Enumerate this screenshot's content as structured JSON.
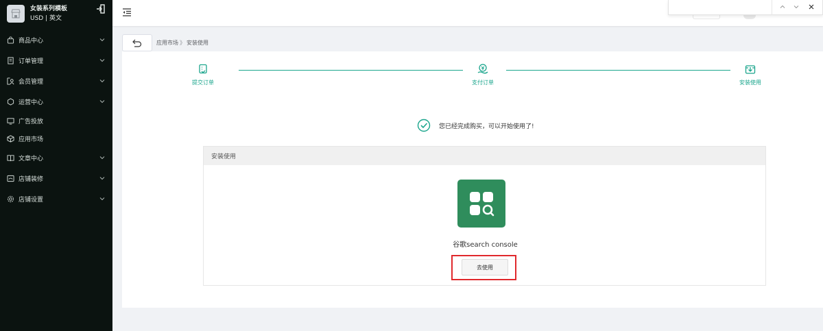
{
  "store": {
    "name": "女装系列模板",
    "currency_lang": "USD | 英文",
    "avatar_icon": "storefront-icon",
    "logout_icon": "logout-icon"
  },
  "sidebar": {
    "items": [
      {
        "label": "商品中心",
        "icon": "bag-icon",
        "has_children": true
      },
      {
        "label": "订单管理",
        "icon": "order-icon",
        "has_children": true
      },
      {
        "label": "会员管理",
        "icon": "member-icon",
        "has_children": true
      },
      {
        "label": "运营中心",
        "icon": "operation-icon",
        "has_children": true
      },
      {
        "label": "广告投放",
        "icon": "monitor-icon",
        "has_children": false
      },
      {
        "label": "应用市场",
        "icon": "cube-icon",
        "has_children": false
      },
      {
        "label": "文章中心",
        "icon": "book-icon",
        "has_children": true
      },
      {
        "label": "店铺装修",
        "icon": "decoration-icon",
        "has_children": true
      },
      {
        "label": "店铺设置",
        "icon": "gear-icon",
        "has_children": true
      }
    ]
  },
  "breadcrumb": {
    "items": [
      "应用市场",
      "安装使用"
    ],
    "separator": "》"
  },
  "steps": [
    {
      "label": "提交订单",
      "icon": "submit-order-icon"
    },
    {
      "label": "支付订单",
      "icon": "pay-order-icon"
    },
    {
      "label": "安装使用",
      "icon": "install-icon"
    }
  ],
  "success_message": "您已经完成购买，可以开始使用了!",
  "install": {
    "header": "安装使用",
    "app_name": "谷歌search console",
    "use_button": "去使用"
  },
  "colors": {
    "accent": "#1aa58c",
    "app_logo_bg": "#2f8d5c",
    "highlight": "#e0282c",
    "sidebar_bg": "#0b1310"
  }
}
